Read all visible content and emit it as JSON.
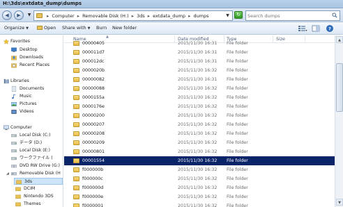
{
  "window": {
    "title": "H:\\3ds\\extdata_dump\\dumps"
  },
  "address": {
    "crumbs": [
      "Computer",
      "Removable Disk (H:)",
      "3ds",
      "extdata_dump",
      "dumps"
    ]
  },
  "search": {
    "placeholder": "Search dumps"
  },
  "toolbar": {
    "organize": "Organize",
    "open": "Open",
    "share_with": "Share with",
    "burn": "Burn",
    "new_folder": "New folder"
  },
  "nav": {
    "favorites": "Favorites",
    "desktop": "Desktop",
    "downloads": "Downloads",
    "recent_places": "Recent Places",
    "libraries": "Libraries",
    "documents": "Documents",
    "music": "Music",
    "pictures": "Pictures",
    "videos": "Videos",
    "computer": "Computer",
    "drive_c": "Local Disk (C:)",
    "drive_d": "データ (D:)",
    "drive_e": "Local Disk (E:)",
    "drive_f": "ワークファイル (",
    "drive_g": "DVD RW Drive (G:)",
    "drive_h": "Removable Disk (H",
    "folder_3ds": "3ds",
    "folder_dcim": "DCIM",
    "folder_nintendo": "Nintendo 3DS",
    "folder_themes": "Themes"
  },
  "columns": {
    "name": "Name",
    "date_modified": "Date modified",
    "type": "Type",
    "size": "Size"
  },
  "files": [
    {
      "name": "00000405",
      "date": "2015/11/30 16:31",
      "type": "File folder"
    },
    {
      "name": "000011d7",
      "date": "2015/11/30 16:31",
      "type": "File folder"
    },
    {
      "name": "000012dc",
      "date": "2015/11/30 16:31",
      "type": "File folder"
    },
    {
      "name": "0000020b",
      "date": "2015/11/30 16:32",
      "type": "File folder"
    },
    {
      "name": "00000082",
      "date": "2015/11/30 16:31",
      "type": "File folder"
    },
    {
      "name": "00000088",
      "date": "2015/11/30 16:32",
      "type": "File folder"
    },
    {
      "name": "0000155a",
      "date": "2015/11/30 16:32",
      "type": "File folder"
    },
    {
      "name": "0000176e",
      "date": "2015/11/30 16:32",
      "type": "File folder"
    },
    {
      "name": "00000200",
      "date": "2015/11/30 16:32",
      "type": "File folder"
    },
    {
      "name": "00000207",
      "date": "2015/11/30 16:32",
      "type": "File folder"
    },
    {
      "name": "00000208",
      "date": "2015/11/30 16:32",
      "type": "File folder"
    },
    {
      "name": "00000209",
      "date": "2015/11/30 16:32",
      "type": "File folder"
    },
    {
      "name": "00000801",
      "date": "2015/11/30 16:32",
      "type": "File folder"
    },
    {
      "name": "00001554",
      "date": "2015/11/30 16:32",
      "type": "File folder"
    },
    {
      "name": "f000000b",
      "date": "2015/11/30 16:32",
      "type": "File folder"
    },
    {
      "name": "f000000c",
      "date": "2015/11/30 16:32",
      "type": "File folder"
    },
    {
      "name": "f000000d",
      "date": "2015/11/30 16:32",
      "type": "File folder"
    },
    {
      "name": "f000000e",
      "date": "2015/11/30 16:32",
      "type": "File folder"
    },
    {
      "name": "f0000001",
      "date": "2015/11/30 16:32",
      "type": "File folder"
    }
  ]
}
